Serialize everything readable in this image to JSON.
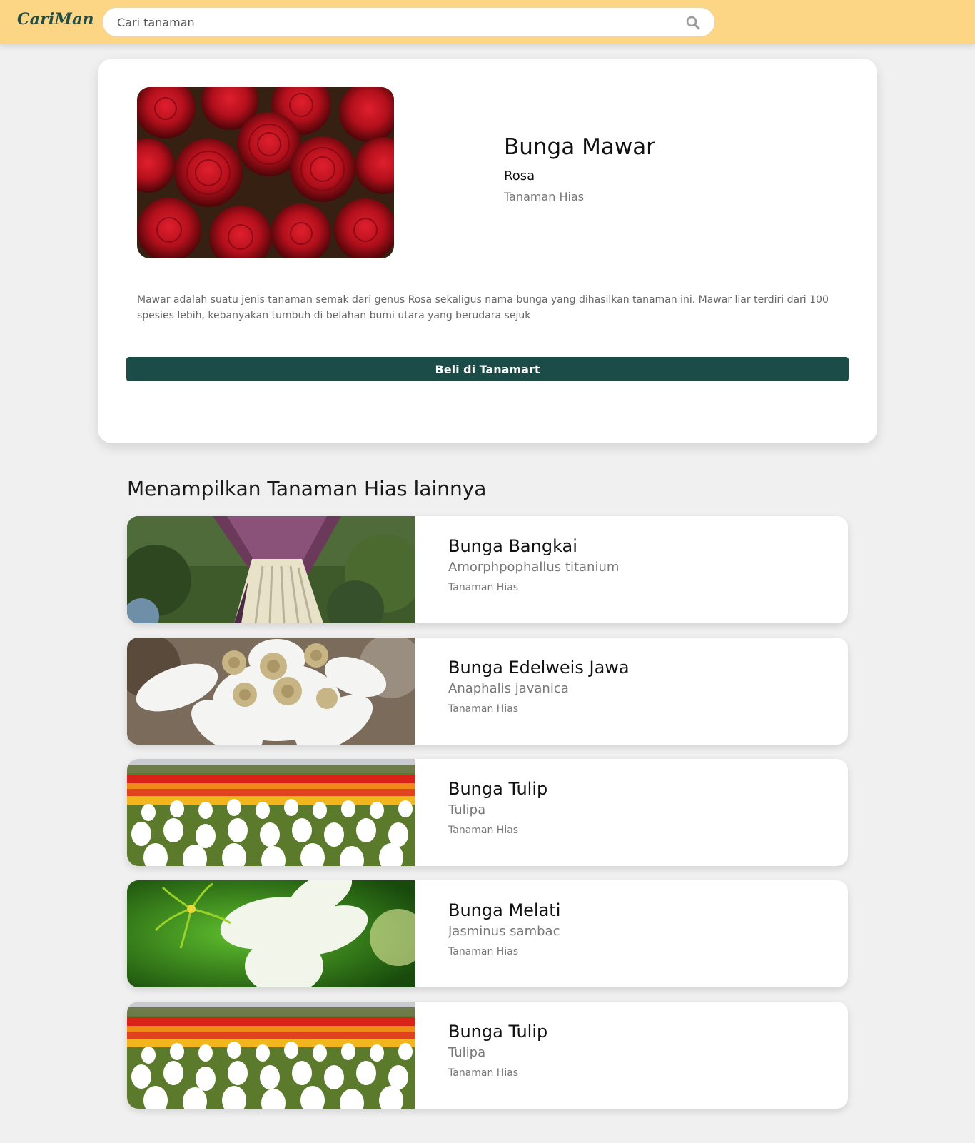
{
  "header": {
    "logo": "CariMan",
    "search_placeholder": "Cari tanaman",
    "search_icon": "search-icon"
  },
  "detail": {
    "image_icon": "rose-flowers-photo",
    "title": "Bunga Mawar",
    "latin": "Rosa",
    "category": "Tanaman Hias",
    "description": "Mawar adalah suatu jenis tanaman semak dari genus Rosa sekaligus nama bunga yang dihasilkan tanaman ini. Mawar liar terdiri dari 100 spesies lebih, kebanyakan tumbuh di belahan bumi utara yang berudara sejuk",
    "buy_label": "Beli di Tanamart",
    "button_color": "#1b4c48"
  },
  "related": {
    "heading": "Menampilkan Tanaman Hias lainnya",
    "items": [
      {
        "name": "Bunga Bangkai",
        "latin": "Amorphpophallus titanium",
        "category": "Tanaman Hias",
        "image": "corpse-flower-photo"
      },
      {
        "name": "Bunga Edelweis Jawa",
        "latin": "Anaphalis javanica",
        "category": "Tanaman Hias",
        "image": "edelweiss-photo"
      },
      {
        "name": "Bunga Tulip",
        "latin": "Tulipa",
        "category": "Tanaman Hias",
        "image": "tulip-field-photo"
      },
      {
        "name": "Bunga Melati",
        "latin": "Jasminus sambac",
        "category": "Tanaman Hias",
        "image": "jasmine-photo"
      },
      {
        "name": "Bunga Tulip",
        "latin": "Tulipa",
        "category": "Tanaman Hias",
        "image": "tulip-field-photo"
      }
    ]
  },
  "colors": {
    "header_bg": "#fcd585",
    "page_bg": "#f0f0f0",
    "logo": "#1e4d4a"
  }
}
